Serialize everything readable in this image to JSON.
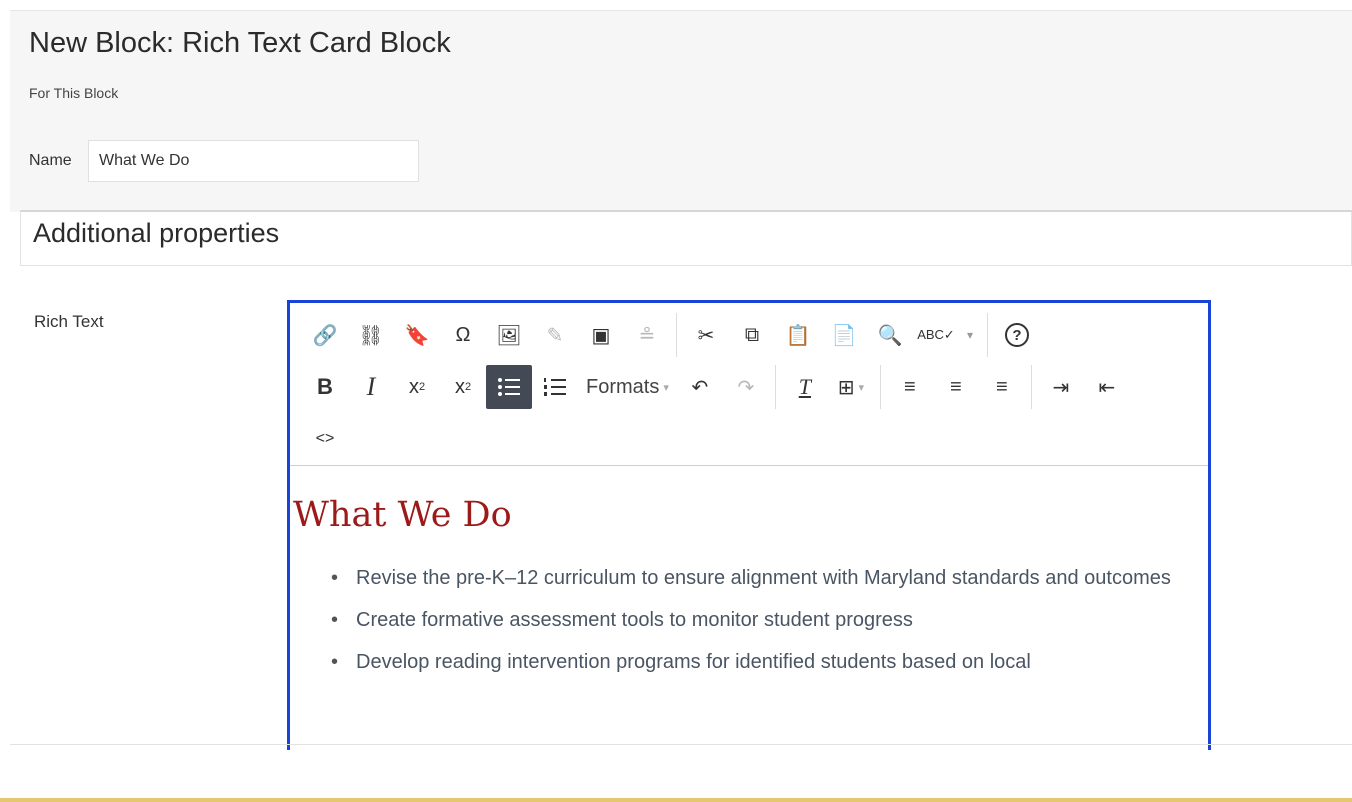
{
  "header": {
    "title": "New Block: Rich Text Card Block",
    "subtitle": "For This Block",
    "name_label": "Name",
    "name_value": "What We Do"
  },
  "properties": {
    "title": "Additional properties"
  },
  "rich_text": {
    "label": "Rich Text",
    "toolbar": {
      "row1": [
        {
          "icon": "link-icon",
          "glyph": "🔗",
          "dim": true
        },
        {
          "icon": "unlink-icon",
          "glyph": "⛓",
          "dim": false
        },
        {
          "icon": "bookmark-icon",
          "glyph": "🔖",
          "dim": false
        },
        {
          "icon": "special-char-icon",
          "glyph": "Ω",
          "dim": false
        },
        {
          "icon": "image-icon",
          "glyph": "🖼",
          "dim": false
        },
        {
          "icon": "edit-image-icon",
          "glyph": "✎",
          "dim": true
        },
        {
          "icon": "media-icon",
          "glyph": "▣",
          "dim": false
        },
        {
          "icon": "personalize-icon",
          "glyph": "≗",
          "dim": true
        },
        {
          "icon": "cut-icon",
          "glyph": "✂",
          "dim": false
        },
        {
          "icon": "copy-icon",
          "glyph": "⧉",
          "dim": false
        },
        {
          "icon": "paste-icon",
          "glyph": "📋",
          "dim": false
        },
        {
          "icon": "paste-text-icon",
          "glyph": "📄",
          "dim": false
        },
        {
          "icon": "find-icon",
          "glyph": "🔍",
          "dim": false
        },
        {
          "icon": "spellcheck-icon",
          "glyph": "ABC✓",
          "dim": false
        },
        {
          "icon": "help-icon",
          "glyph": "?",
          "dim": false
        }
      ],
      "row2": {
        "bold": "B",
        "italic": "I",
        "superscript": "x",
        "subscript": "x",
        "formats": "Formats",
        "undo": "↶",
        "redo": "↷",
        "clear_format": "T",
        "table": "⊞",
        "align_left": "≡",
        "align_center": "≡",
        "align_right": "≡",
        "indent": "⇥",
        "outdent": "⇤"
      },
      "row3": {
        "source_code": "<>"
      }
    },
    "content": {
      "heading": "What We Do",
      "bullets": [
        "Revise the pre-K–12 curriculum to ensure alignment with Maryland standards and outcomes",
        "Create formative assessment tools to monitor student progress",
        "Develop reading intervention programs for identified students based on local"
      ]
    }
  },
  "colors": {
    "editor_border": "#1a44d8",
    "heading_color": "#9c1a1a",
    "active_button": "#434a56",
    "footer_accent": "#e5c770"
  }
}
